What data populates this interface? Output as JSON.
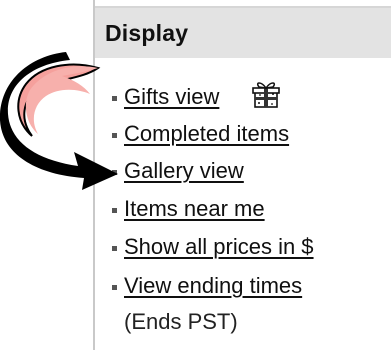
{
  "panel": {
    "title": "Display",
    "items": [
      {
        "label": "Gifts view",
        "icon": "gift-icon"
      },
      {
        "label": "Completed items"
      },
      {
        "label": "Gallery view"
      },
      {
        "label": "Items near me"
      },
      {
        "label": "Show all prices in $"
      },
      {
        "label": "View ending times",
        "note": "(Ends PST)"
      }
    ]
  },
  "colors": {
    "header_bg": "#e3e3e3",
    "arrow_fill": "#f5a09c",
    "arrow_outline": "#000000",
    "link_text": "#101010"
  },
  "annotation": {
    "icon": "curved-pointer-arrow",
    "points_to": "Gallery view"
  }
}
